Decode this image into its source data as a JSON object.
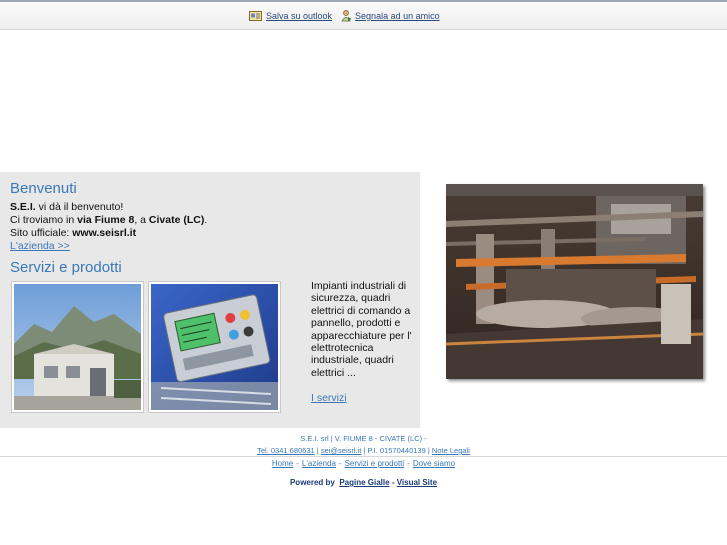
{
  "toolbar": {
    "save_outlook": "Salva su outlook",
    "tell_friend": "Segnala ad un amico"
  },
  "welcome": {
    "title": "Benvenuti",
    "company": "S.E.I.",
    "greeting": " vi dà il benvenuto!",
    "location_prefix": "Ci troviamo in ",
    "street": "via Fiume 8",
    "location_mid": ", a ",
    "city": "Civate (LC)",
    "location_suffix": ".",
    "site_prefix": "Sito ufficiale: ",
    "site": "www.seisrl.it",
    "link": "L'azienda >>"
  },
  "services": {
    "title": "Servizi e prodotti",
    "description": "Impianti industriali di sicurezza, quadri elettrici di comando a pannello, prodotti e apparecchiature per l' elettrotecnica industriale, quadri elettrici ...",
    "link": "I servizi"
  },
  "footer": {
    "line1": "S.E.I. srl | V. FIUME 8 - CIVATE (LC) -",
    "tel": "Tel. 0341 680631",
    "email": "sei@seisrl.it",
    "piva": "P.I. 01570440139",
    "legal": "Note Legali",
    "nav": [
      "Home",
      "L'azienda",
      "Servizi e prodotti",
      "Dove siamo"
    ],
    "powered_label": "Powered by",
    "pagine_gialle": "Pagine Gialle",
    "visual_site": "Visual Site"
  },
  "colors": {
    "accent": "#3a78b8",
    "panel": "#e8e8e8",
    "powered": "#1a3a78"
  },
  "icons": {
    "save_outlook": "outlook-card-icon",
    "tell_friend": "person-send-icon"
  }
}
